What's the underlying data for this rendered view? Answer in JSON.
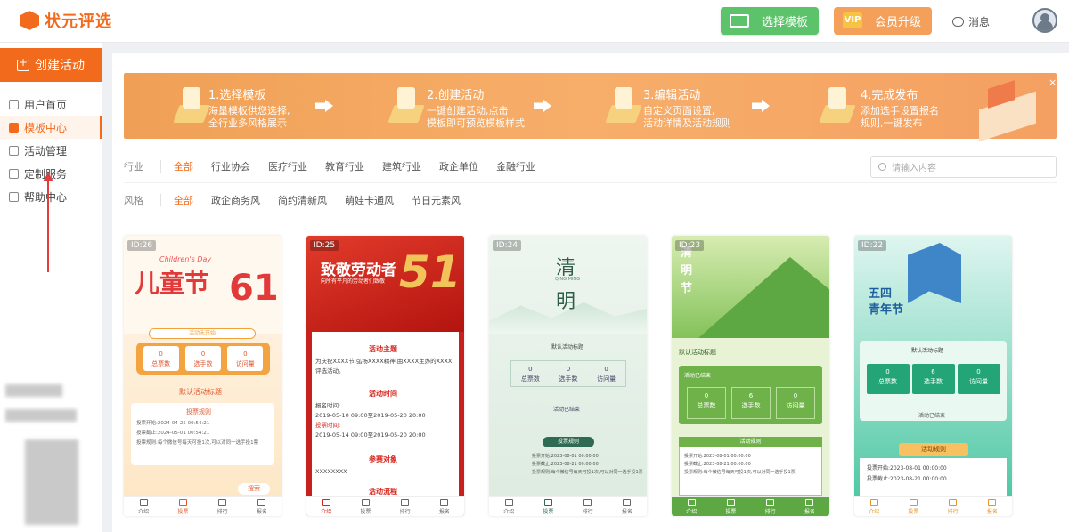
{
  "header": {
    "brand": "状元评选",
    "select_template": "选择模板",
    "vip_badge": "VIP",
    "vip_upgrade": "会员升级",
    "messages": "消息"
  },
  "sidebar": {
    "create": "创建活动",
    "items": [
      {
        "label": "用户首页"
      },
      {
        "label": "模板中心"
      },
      {
        "label": "活动管理"
      },
      {
        "label": "定制服务"
      },
      {
        "label": "帮助中心"
      }
    ],
    "active_index": 1
  },
  "banner": {
    "close": "×",
    "steps": [
      {
        "title": "1.选择模板",
        "desc1": "海量模板供您选择,",
        "desc2": "全行业多风格展示"
      },
      {
        "title": "2.创建活动",
        "desc1": "一键创建活动,点击",
        "desc2": "模板即可预览模板样式"
      },
      {
        "title": "3.编辑活动",
        "desc1": "自定义页面设置,",
        "desc2": "活动详情及活动规则"
      },
      {
        "title": "4.完成发布",
        "desc1": "添加选手设置报名",
        "desc2": "规则,一键发布"
      }
    ]
  },
  "filters": {
    "industry": {
      "label": "行业",
      "options": [
        "全部",
        "行业协会",
        "医疗行业",
        "教育行业",
        "建筑行业",
        "政企单位",
        "金融行业"
      ],
      "selected": 0
    },
    "style": {
      "label": "风格",
      "options": [
        "全部",
        "政企商务风",
        "简约清新风",
        "萌娃卡通风",
        "节日元素风"
      ],
      "selected": 0
    },
    "search_placeholder": "请输入内容"
  },
  "cards": [
    {
      "id": "ID:26",
      "title": "儿童节",
      "subtitle": "Children's Day",
      "num": "61",
      "stats": [
        {
          "v": "0",
          "l": "总票数"
        },
        {
          "v": "0",
          "l": "选手数"
        },
        {
          "v": "0",
          "l": "访问量"
        }
      ],
      "t1": "活动未开始",
      "t2": "默认活动标题",
      "rules_title": "投票规则",
      "r1": "投票开始:2024-04-25 00:54:21",
      "r2": "投票截止:2024-05-01 00:54:21",
      "r3": "投票规则:每个微信号每天可投1次,可以对同一选手投1票",
      "search_btn": "搜索",
      "tabs": [
        "介绍",
        "投票",
        "排行",
        "报名"
      ]
    },
    {
      "id": "ID:25",
      "title": "致敬劳动者",
      "subtitle": "向所有平凡的劳动者们致敬",
      "num": "51",
      "s1": "活动主题",
      "p1": "为庆祝XXXX节,弘扬XXXX精神,由XXXX主办的XXXX评选活动。",
      "s2": "活动时间",
      "p2a": "报名时间:",
      "p2b": "2019-05-10 09:00至2019-05-20 20:00",
      "p2c": "投票时间:",
      "p2d": "2019-05-14 09:00至2019-05-20 20:00",
      "s3": "参赛对象",
      "p3": "XXXXXXXX",
      "s4": "活动流程",
      "tabs": [
        "介绍",
        "投票",
        "排行",
        "报名"
      ]
    },
    {
      "id": "ID:24",
      "title1": "清",
      "title2": "明",
      "pinyin": "QING MING",
      "t1": "默认活动标题",
      "stats": [
        {
          "v": "0",
          "l": "总票数"
        },
        {
          "v": "0",
          "l": "选手数"
        },
        {
          "v": "0",
          "l": "访问量"
        }
      ],
      "t2": "活动已结束",
      "rules_title": "投票规则",
      "r1": "投票开始:2023-08-01 00:00:00",
      "r2": "投票截止:2023-08-21 00:00:00",
      "r3": "投票规则:每个微信号每天可投1次,可以对同一选手投1票",
      "tabs": [
        "介绍",
        "投票",
        "排行",
        "报名"
      ]
    },
    {
      "id": "ID:23",
      "title1": "清",
      "title2": "明",
      "title3": "节",
      "t1": "默认活动标题",
      "t2": "活动已结束",
      "stats": [
        {
          "v": "0",
          "l": "总票数"
        },
        {
          "v": "6",
          "l": "选手数"
        },
        {
          "v": "0",
          "l": "访问量"
        }
      ],
      "rules_title": "活动规则",
      "r1": "投票开始:2023-08-01 00:00:00",
      "r2": "投票截止:2023-08-21 00:00:00",
      "r3": "投票规则:每个微信号每天可投1次,可以对同一选手投1票",
      "tabs": [
        "介绍",
        "投票",
        "排行",
        "报名"
      ]
    },
    {
      "id": "ID:22",
      "title1": "五四",
      "title2": "青年节",
      "t1": "默认活动标题",
      "stats": [
        {
          "v": "0",
          "l": "总票数"
        },
        {
          "v": "6",
          "l": "选手数"
        },
        {
          "v": "0",
          "l": "访问量"
        }
      ],
      "t2": "活动已结束",
      "rules_title": "活动规则",
      "r1": "投票开始:2023-08-01 00:00:00",
      "r2": "投票截止:2023-08-21 00:00:00",
      "tabs": [
        "介绍",
        "投票",
        "排行",
        "报名"
      ]
    }
  ],
  "colors": {
    "brand": "#f26a1b",
    "green": "#5cc36a",
    "banner": "#f4a062"
  }
}
